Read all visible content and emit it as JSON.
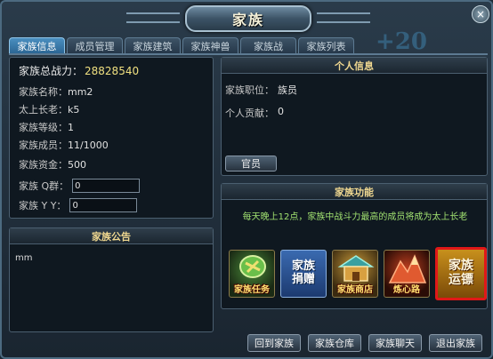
{
  "window": {
    "title": "家族",
    "close_symbol": "×"
  },
  "tabs": [
    {
      "label": "家族信息",
      "active": true
    },
    {
      "label": "成员管理",
      "active": false
    },
    {
      "label": "家族建筑",
      "active": false
    },
    {
      "label": "家族神兽",
      "active": false
    },
    {
      "label": "家族战",
      "active": false
    },
    {
      "label": "家族列表",
      "active": false
    }
  ],
  "clan_info": {
    "power_label": "家族总战力：",
    "power_value": "28828540",
    "name_label": "家族名称：",
    "name_value": "mm2",
    "elder_label": "太上长老：",
    "elder_value": "k5",
    "level_label": "家族等级：",
    "level_value": "1",
    "members_label": "家族成员：",
    "members_value": "11/1000",
    "funds_label": "家族资金：",
    "funds_value": "500",
    "qq_label": "家族 Q群：",
    "qq_value": "0",
    "yy_label": "家族 Y Y：",
    "yy_value": "0"
  },
  "notice": {
    "title": "家族公告",
    "text": "mm"
  },
  "personal": {
    "title": "个人信息",
    "position_label": "家族职位：",
    "position_value": "族员",
    "contribution_label": "个人贡献：",
    "contribution_value": "0",
    "officer_button": "官员"
  },
  "functions": {
    "title": "家族功能",
    "description": "每天晚上12点，家族中战斗力最高的成员将成为太上长老",
    "items": [
      {
        "label": "家族任务",
        "icon": "scroll-icon"
      },
      {
        "label": "家族捐赠",
        "icon": "donate-icon"
      },
      {
        "label": "家族商店",
        "icon": "shop-icon"
      },
      {
        "label": "炼心路",
        "icon": "mountain-icon"
      },
      {
        "label": "家族运镖",
        "icon": "escort-icon"
      }
    ]
  },
  "bottom_buttons": {
    "return": "回到家族",
    "warehouse": "家族仓库",
    "chat": "家族聊天",
    "leave": "退出家族"
  },
  "decoration_text": "+20",
  "colors": {
    "accent": "#f0d890",
    "highlight": "#e01818",
    "desc_green": "#a0e070"
  }
}
